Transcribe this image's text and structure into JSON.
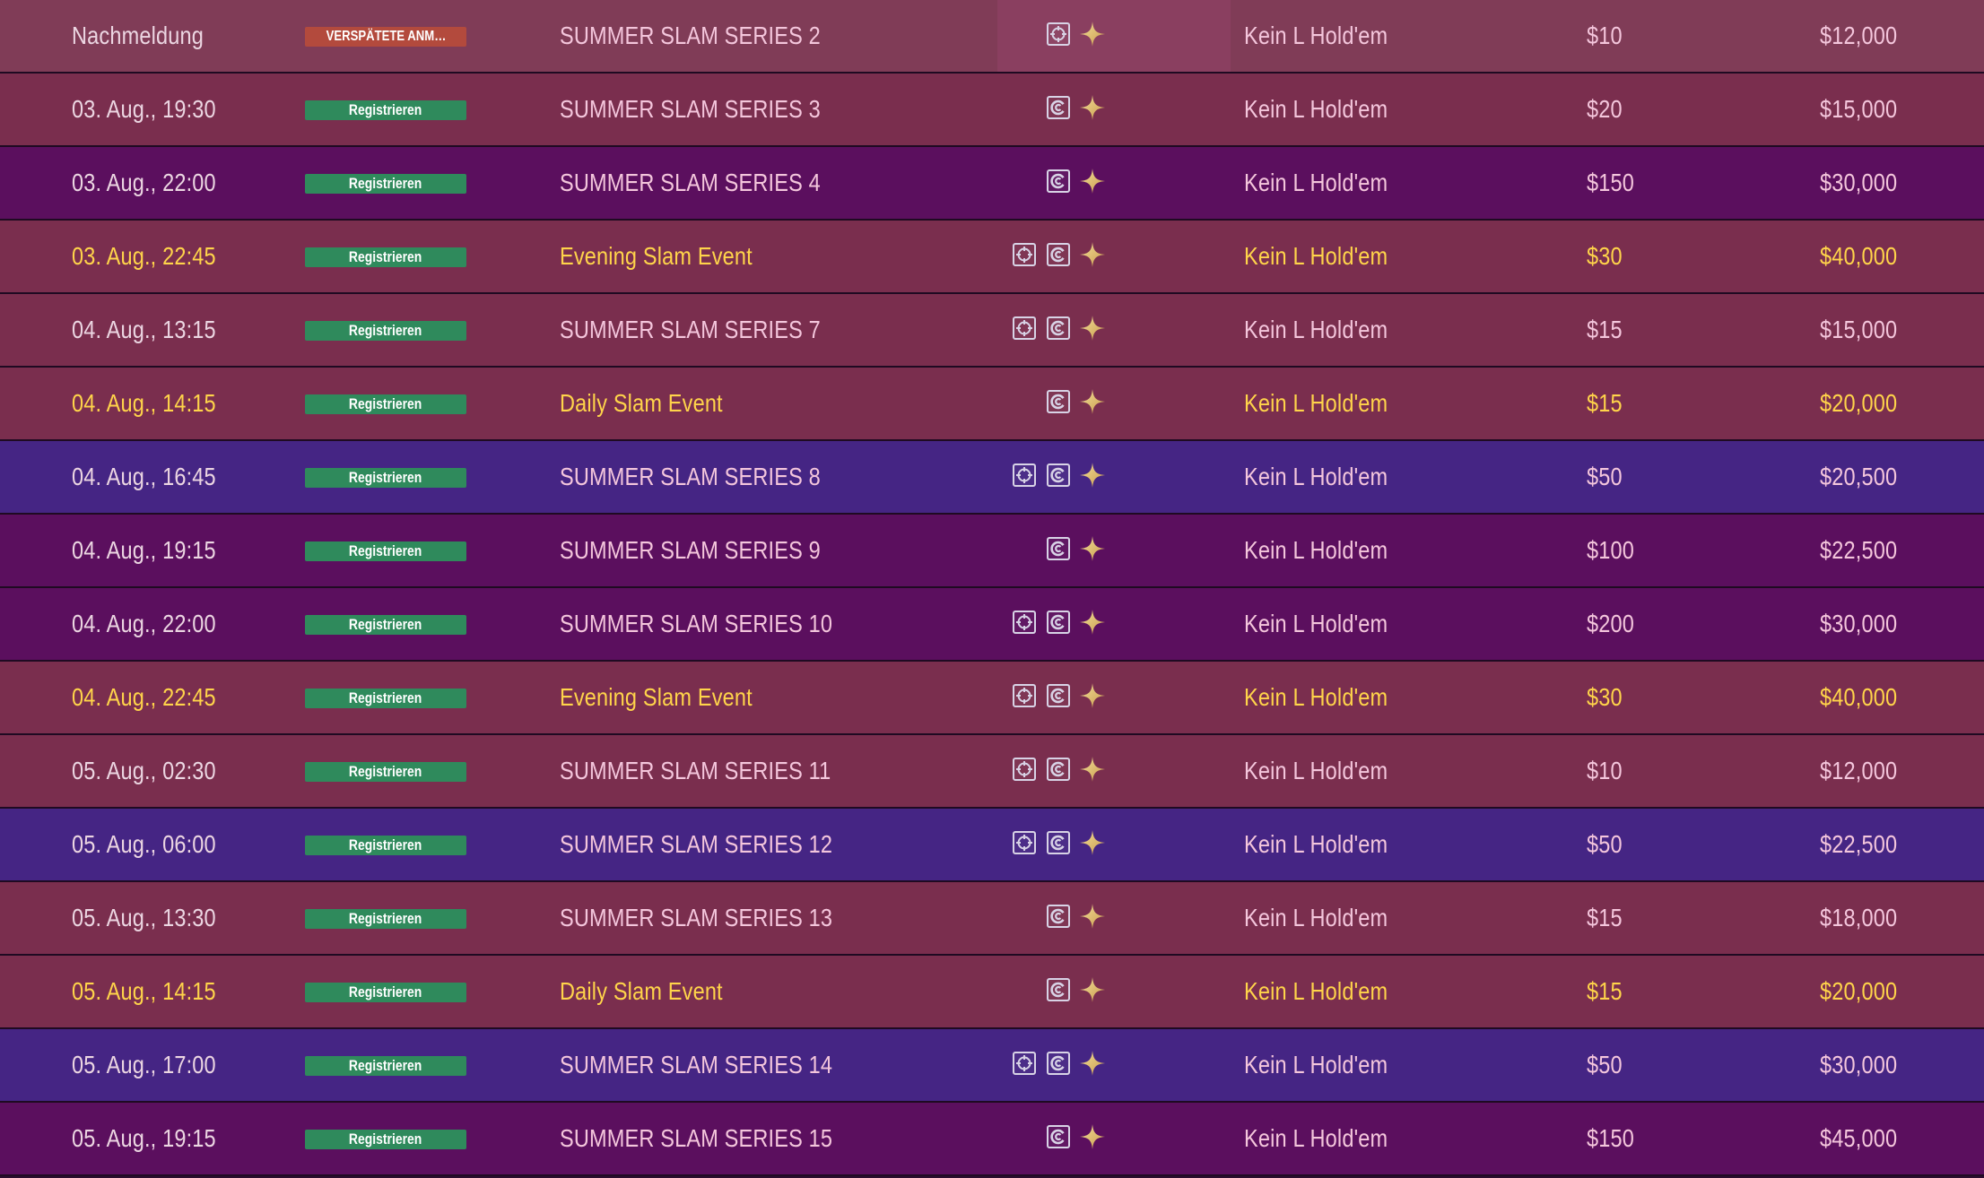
{
  "register_label": "Registrieren",
  "late_label": "VERSPÄTETE ANM…",
  "colors": {
    "maroon": "#7a2e4e",
    "purple": "#5b0f5e",
    "blue": "#452584",
    "highlight_text": "#ffd44a",
    "register_button": "#2f8a5c",
    "late_button": "#b34a3d"
  },
  "icon_names": [
    "target-icon",
    "currency-icon",
    "sparkle-icon"
  ],
  "rows": [
    {
      "date": "Nachmeldung",
      "status": "late",
      "name": "SUMMER SLAM SERIES 2",
      "icons": [
        "target",
        "sparkle"
      ],
      "game": "Kein L Hold'em",
      "buyin": "$10",
      "prize": "$12,000",
      "tone": "maroon-top",
      "highlight": false,
      "selected": true
    },
    {
      "date": "03. Aug., 19:30",
      "status": "register",
      "name": "SUMMER SLAM SERIES 3",
      "icons": [
        "currency",
        "sparkle"
      ],
      "game": "Kein L Hold'em",
      "buyin": "$20",
      "prize": "$15,000",
      "tone": "maroon",
      "highlight": false
    },
    {
      "date": "03. Aug., 22:00",
      "status": "register",
      "name": "SUMMER SLAM SERIES 4",
      "icons": [
        "currency",
        "sparkle"
      ],
      "game": "Kein L Hold'em",
      "buyin": "$150",
      "prize": "$30,000",
      "tone": "purple",
      "highlight": false
    },
    {
      "date": "03. Aug., 22:45",
      "status": "register",
      "name": "Evening Slam Event",
      "icons": [
        "target",
        "currency",
        "sparkle"
      ],
      "game": "Kein L Hold'em",
      "buyin": "$30",
      "prize": "$40,000",
      "tone": "maroon",
      "highlight": true
    },
    {
      "date": "04. Aug., 13:15",
      "status": "register",
      "name": "SUMMER SLAM SERIES 7",
      "icons": [
        "target",
        "currency",
        "sparkle"
      ],
      "game": "Kein L Hold'em",
      "buyin": "$15",
      "prize": "$15,000",
      "tone": "maroon",
      "highlight": false
    },
    {
      "date": "04. Aug., 14:15",
      "status": "register",
      "name": "Daily Slam Event",
      "icons": [
        "currency",
        "sparkle"
      ],
      "game": "Kein L Hold'em",
      "buyin": "$15",
      "prize": "$20,000",
      "tone": "maroon",
      "highlight": true
    },
    {
      "date": "04. Aug., 16:45",
      "status": "register",
      "name": "SUMMER SLAM SERIES 8",
      "icons": [
        "target",
        "currency",
        "sparkle"
      ],
      "game": "Kein L Hold'em",
      "buyin": "$50",
      "prize": "$20,500",
      "tone": "blue",
      "highlight": false
    },
    {
      "date": "04. Aug., 19:15",
      "status": "register",
      "name": "SUMMER SLAM SERIES 9",
      "icons": [
        "currency",
        "sparkle"
      ],
      "game": "Kein L Hold'em",
      "buyin": "$100",
      "prize": "$22,500",
      "tone": "purple",
      "highlight": false
    },
    {
      "date": "04. Aug., 22:00",
      "status": "register",
      "name": "SUMMER SLAM SERIES 10",
      "icons": [
        "target",
        "currency",
        "sparkle"
      ],
      "game": "Kein L Hold'em",
      "buyin": "$200",
      "prize": "$30,000",
      "tone": "purple",
      "highlight": false
    },
    {
      "date": "04. Aug., 22:45",
      "status": "register",
      "name": "Evening Slam Event",
      "icons": [
        "target",
        "currency",
        "sparkle"
      ],
      "game": "Kein L Hold'em",
      "buyin": "$30",
      "prize": "$40,000",
      "tone": "maroon",
      "highlight": true
    },
    {
      "date": "05. Aug., 02:30",
      "status": "register",
      "name": "SUMMER SLAM SERIES 11",
      "icons": [
        "target",
        "currency",
        "sparkle"
      ],
      "game": "Kein L Hold'em",
      "buyin": "$10",
      "prize": "$12,000",
      "tone": "maroon",
      "highlight": false
    },
    {
      "date": "05. Aug., 06:00",
      "status": "register",
      "name": "SUMMER SLAM SERIES 12",
      "icons": [
        "target",
        "currency",
        "sparkle"
      ],
      "game": "Kein L Hold'em",
      "buyin": "$50",
      "prize": "$22,500",
      "tone": "blue",
      "highlight": false
    },
    {
      "date": "05. Aug., 13:30",
      "status": "register",
      "name": "SUMMER SLAM SERIES 13",
      "icons": [
        "currency",
        "sparkle"
      ],
      "game": "Kein L Hold'em",
      "buyin": "$15",
      "prize": "$18,000",
      "tone": "maroon",
      "highlight": false
    },
    {
      "date": "05. Aug., 14:15",
      "status": "register",
      "name": "Daily Slam Event",
      "icons": [
        "currency",
        "sparkle"
      ],
      "game": "Kein L Hold'em",
      "buyin": "$15",
      "prize": "$20,000",
      "tone": "maroon",
      "highlight": true
    },
    {
      "date": "05. Aug., 17:00",
      "status": "register",
      "name": "SUMMER SLAM SERIES 14",
      "icons": [
        "target",
        "currency",
        "sparkle"
      ],
      "game": "Kein L Hold'em",
      "buyin": "$50",
      "prize": "$30,000",
      "tone": "blue",
      "highlight": false
    },
    {
      "date": "05. Aug., 19:15",
      "status": "register",
      "name": "SUMMER SLAM SERIES 15",
      "icons": [
        "currency",
        "sparkle"
      ],
      "game": "Kein L Hold'em",
      "buyin": "$150",
      "prize": "$45,000",
      "tone": "purple",
      "highlight": false
    }
  ]
}
